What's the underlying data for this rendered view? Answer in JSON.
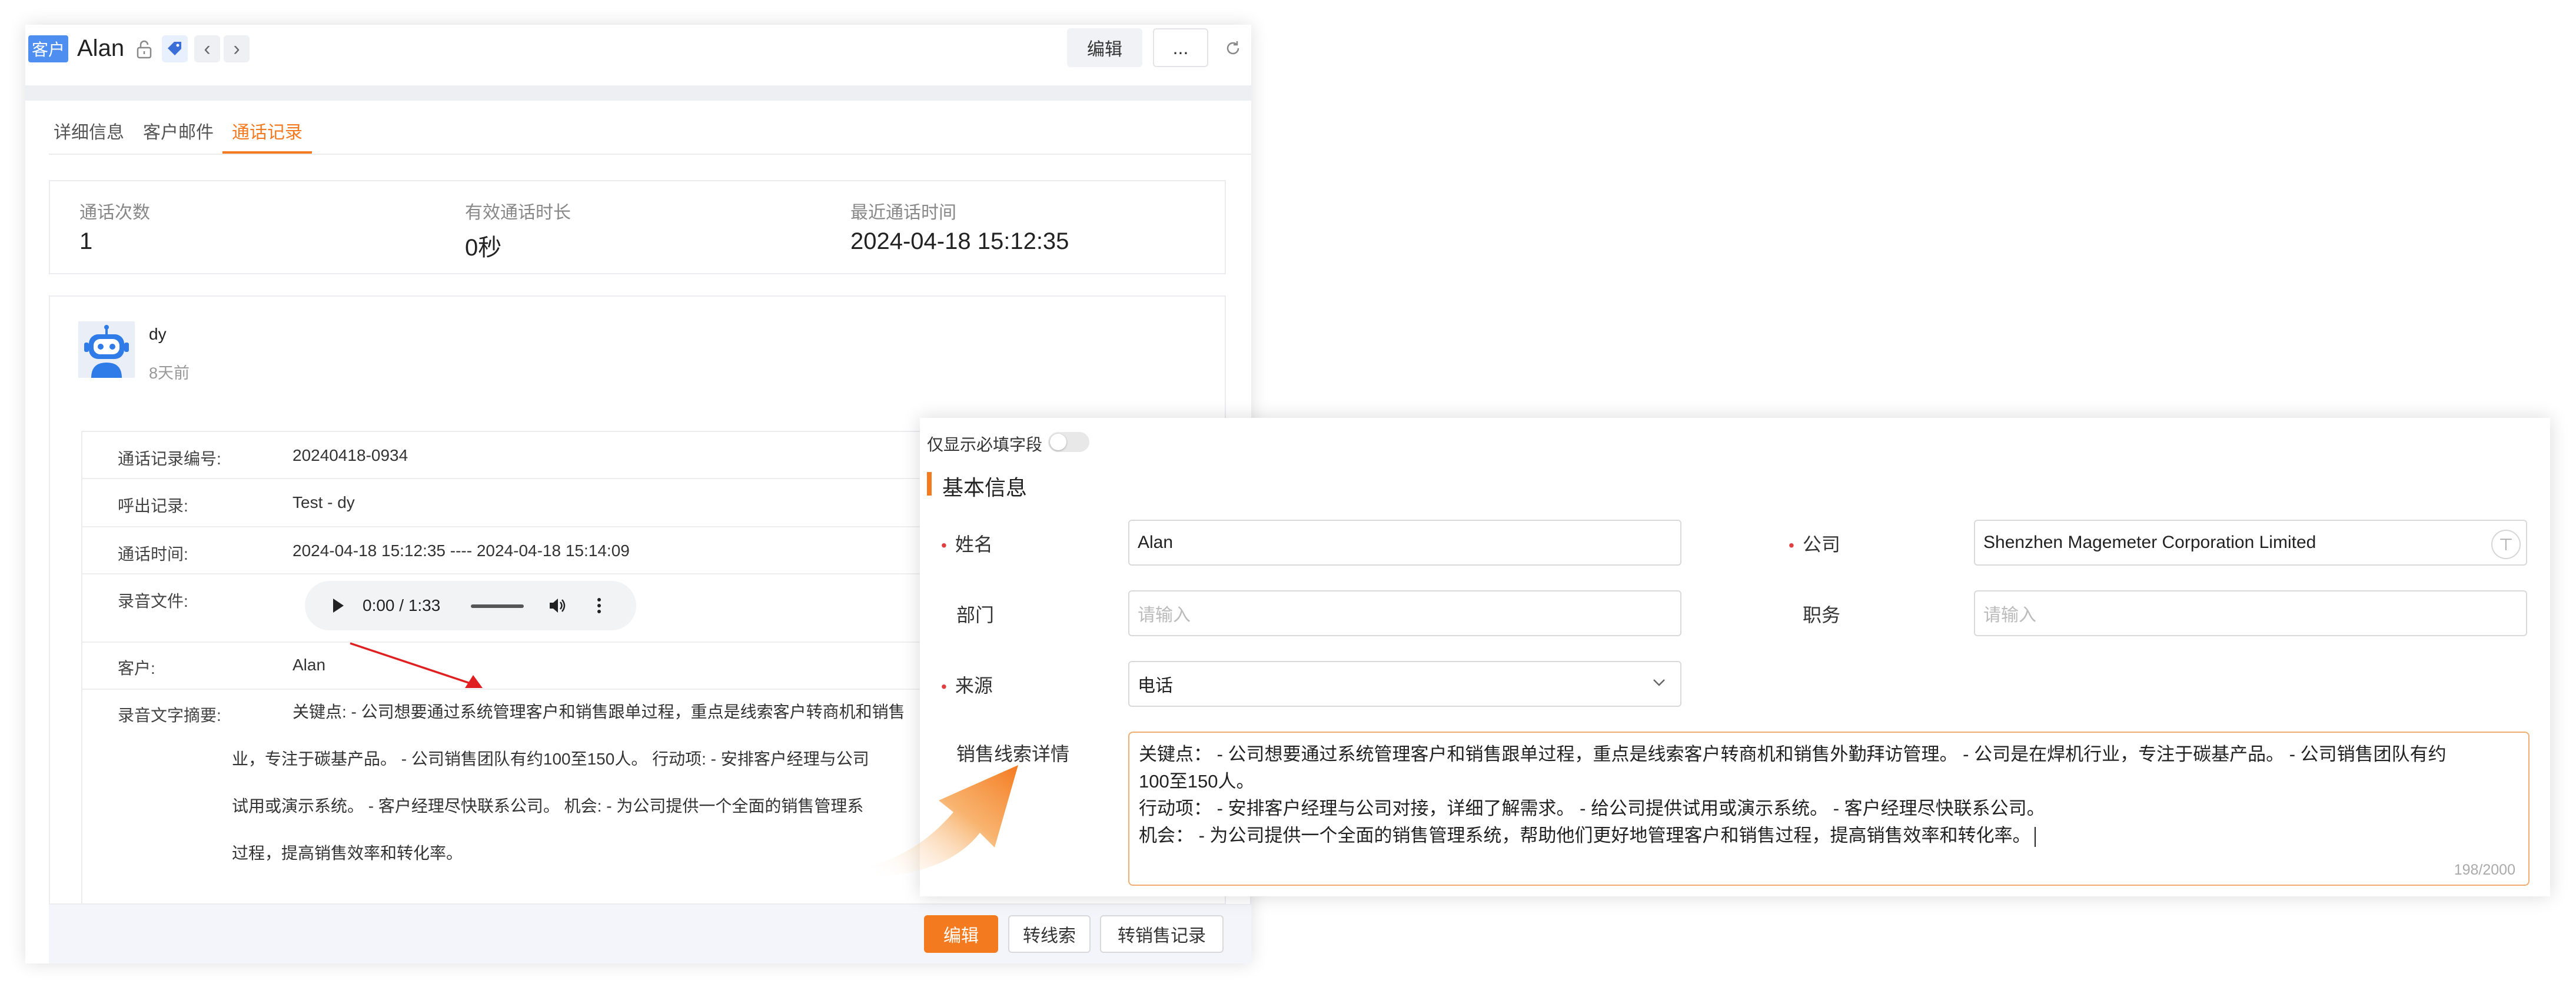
{
  "header": {
    "badge": "客户",
    "name": "Alan",
    "edit_label": "编辑",
    "more_label": "..."
  },
  "tabs": [
    {
      "label": "详细信息",
      "active": false
    },
    {
      "label": "客户邮件",
      "active": false
    },
    {
      "label": "通话记录",
      "active": true
    }
  ],
  "stats": {
    "count_label": "通话次数",
    "count_value": "1",
    "duration_label": "有效通话时长",
    "duration_value": "0秒",
    "last_label": "最近通话时间",
    "last_value": "2024-04-18 15:12:35"
  },
  "record": {
    "user": "dy",
    "time_ago": "8天前",
    "rows": [
      {
        "label": "通话记录编号:",
        "value": "20240418-0934"
      },
      {
        "label": "呼出记录:",
        "value": "Test - dy"
      },
      {
        "label": "通话时间:",
        "value": "2024-04-18 15:12:35 ---- 2024-04-18 15:14:09"
      },
      {
        "label": "录音文件:",
        "value": ""
      },
      {
        "label": "客户:",
        "value": "Alan"
      }
    ],
    "audio_time": "0:00 / 1:33",
    "summary_label": "录音文字摘要:",
    "summary_lines": [
      "关键点:  - 公司想要通过系统管理客户和销售跟单过程，重点是线索客户转商机和销售",
      "业，专注于碳基产品。 - 公司销售团队有约100至150人。 行动项:  - 安排客户经理与公司",
      "试用或演示系统。 - 客户经理尽快联系公司。 机会:  - 为公司提供一个全面的销售管理系",
      "过程，提高销售效率和转化率。"
    ]
  },
  "footer": {
    "edit": "编辑",
    "to_lead": "转线索",
    "to_sales": "转销售记录"
  },
  "form": {
    "toggle_label": "仅显示必填字段",
    "section_title": "基本信息",
    "name_label": "姓名",
    "name_value": "Alan",
    "company_label": "公司",
    "company_value": "Shenzhen Magemeter Corporation Limited",
    "dept_label": "部门",
    "dept_placeholder": "请输入",
    "title_label": "职务",
    "title_placeholder": "请输入",
    "source_label": "来源",
    "source_value": "电话",
    "detail_label": "销售线索详情",
    "detail_lines": [
      "关键点：  - 公司想要通过系统管理客户和销售跟单过程，重点是线索客户转商机和销售外勤拜访管理。  - 公司是在焊机行业，专注于碳基产品。  - 公司销售团队有约",
      "100至150人。",
      "行动项：  - 安排客户经理与公司对接，详细了解需求。  - 给公司提供试用或演示系统。  - 客户经理尽快联系公司。",
      " 机会：  - 为公司提供一个全面的销售管理系统，帮助他们更好地管理客户和销售过程，提高销售效率和转化率。"
    ],
    "char_count": "198/2000"
  },
  "colors": {
    "accent": "#f47a20",
    "badge": "#4d8ef0",
    "required": "#e04040"
  }
}
